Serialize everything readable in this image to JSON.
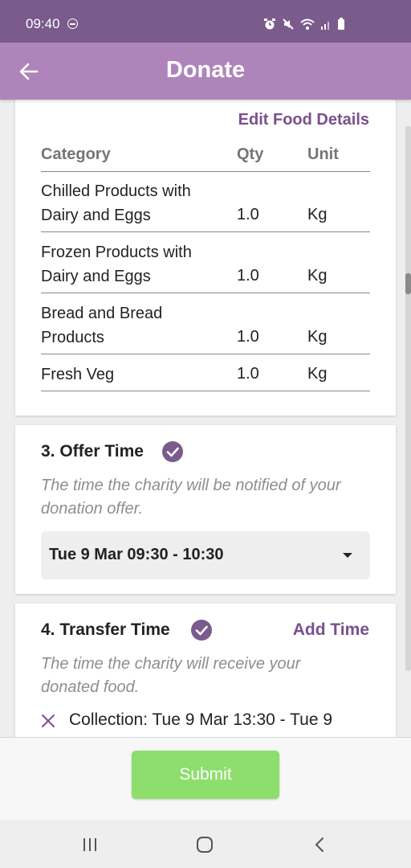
{
  "status": {
    "time": "09:40"
  },
  "header": {
    "title": "Donate"
  },
  "food_card": {
    "edit_link": "Edit Food Details",
    "columns": {
      "category": "Category",
      "qty": "Qty",
      "unit": "Unit"
    },
    "rows": [
      {
        "category": "Chilled Products with Dairy and Eggs",
        "qty": "1.0",
        "unit": "Kg"
      },
      {
        "category": "Frozen Products with Dairy and Eggs",
        "qty": "1.0",
        "unit": "Kg"
      },
      {
        "category": "Bread and Bread Products",
        "qty": "1.0",
        "unit": "Kg"
      },
      {
        "category": "Fresh Veg",
        "qty": "1.0",
        "unit": "Kg"
      }
    ]
  },
  "offer_card": {
    "title": "3. Offer Time",
    "description": "The time the charity will be notified of your donation offer.",
    "selected_time": "Tue 9 Mar 09:30 - 10:30"
  },
  "transfer_card": {
    "title": "4. Transfer Time",
    "add_link": "Add Time",
    "description": "The time the charity will receive your donated food.",
    "collection": "Collection: Tue 9 Mar 13:30 - Tue 9"
  },
  "footer": {
    "submit_label": "Submit"
  },
  "colors": {
    "primary": "#ae84bb",
    "status_bar": "#7b5a8c",
    "accent": "#7b4f8d",
    "submit": "#8ede6e"
  },
  "icons": [
    "back-arrow-icon",
    "check-circle-icon",
    "dropdown-arrow-icon",
    "remove-x-icon",
    "alarm-icon",
    "mute-icon",
    "wifi-icon",
    "signal-icon",
    "battery-icon",
    "do-not-disturb-icon"
  ]
}
